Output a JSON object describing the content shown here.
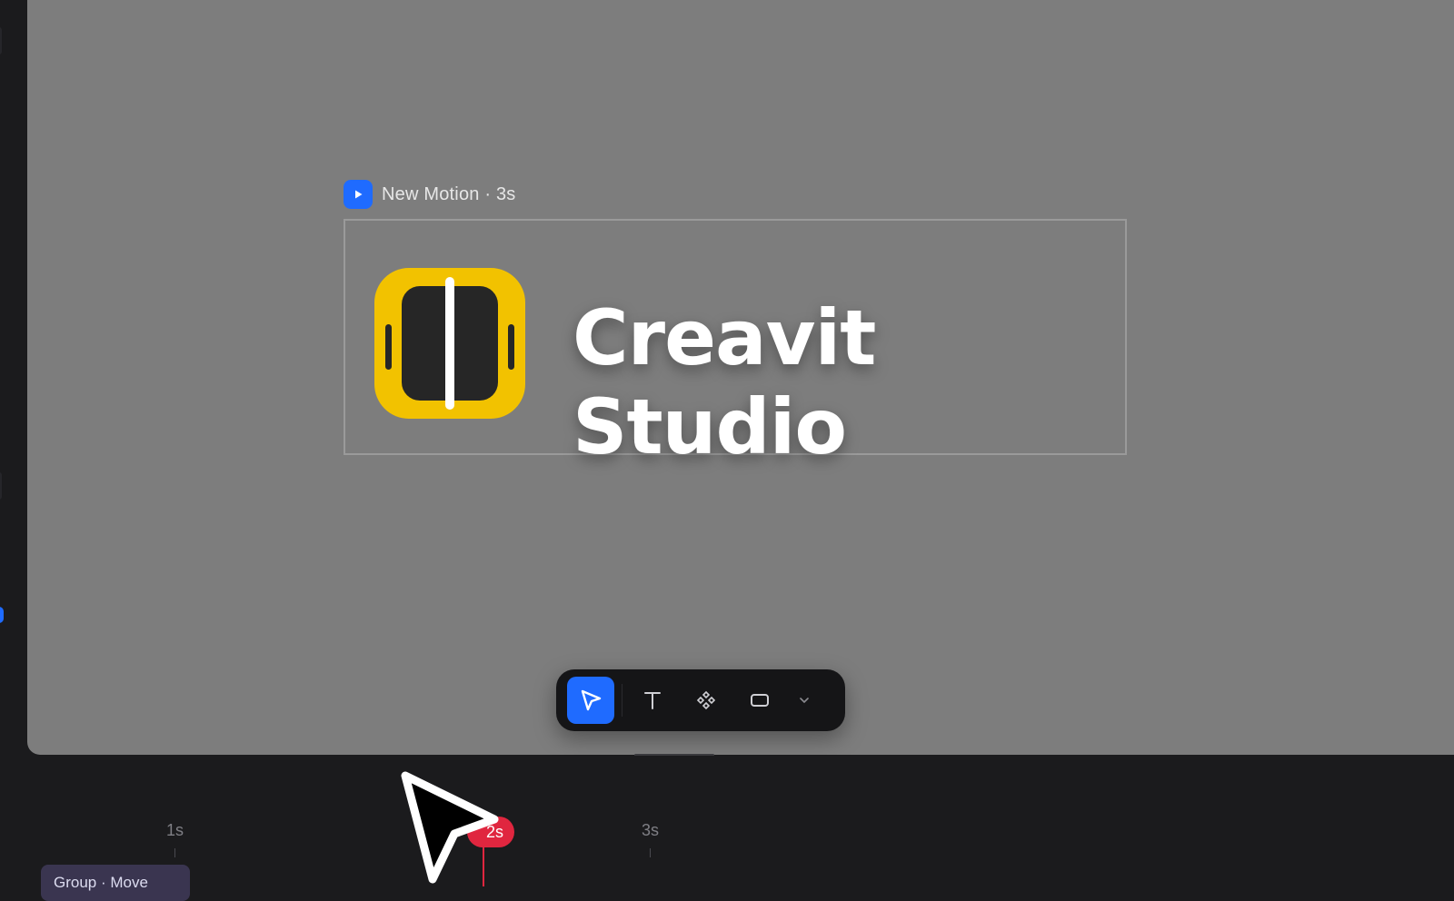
{
  "canvas": {
    "frame_title": "New Motion · 3s",
    "brand_text": "Creavit Studio",
    "logo_color": "#F2C200",
    "accent_color": "#1F6BFF"
  },
  "toolbar": {
    "tools": [
      {
        "name": "select-tool",
        "icon": "cursor-arrow-icon",
        "active": true
      },
      {
        "name": "text-tool",
        "icon": "text-t-icon",
        "label": "T"
      },
      {
        "name": "component-tool",
        "icon": "component-diamond-icon"
      },
      {
        "name": "shape-tool",
        "icon": "rectangle-icon"
      },
      {
        "name": "more-tools",
        "icon": "chevron-down-icon"
      }
    ]
  },
  "timeline": {
    "ticks": [
      "1s",
      "2s",
      "3s"
    ],
    "playhead_color": "#E0263F",
    "clip_label": "Group · Move"
  }
}
